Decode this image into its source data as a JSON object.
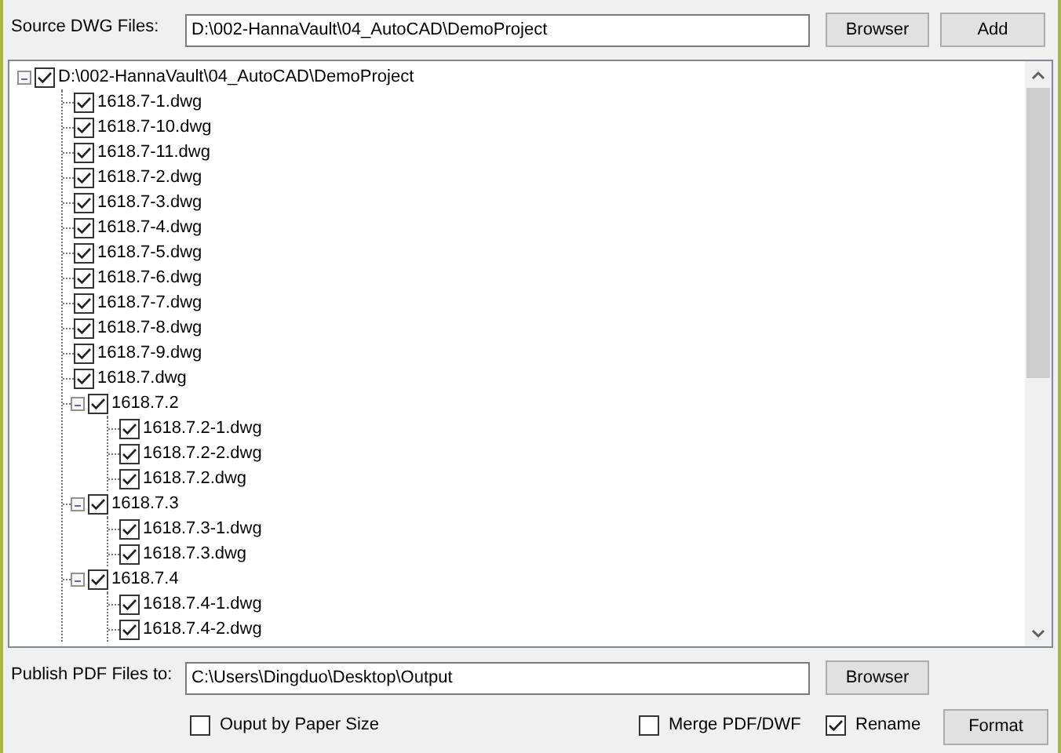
{
  "source": {
    "label": "Source DWG Files:",
    "value": "D:\\002-HannaVault\\04_AutoCAD\\DemoProject",
    "buttons": [
      "Browser",
      "Add"
    ]
  },
  "tree": {
    "label": "D:\\002-HannaVault\\04_AutoCAD\\DemoProject",
    "checked": true,
    "expanded": true,
    "children": [
      {
        "label": "1618.7-1.dwg",
        "checked": true
      },
      {
        "label": "1618.7-10.dwg",
        "checked": true
      },
      {
        "label": "1618.7-11.dwg",
        "checked": true
      },
      {
        "label": "1618.7-2.dwg",
        "checked": true
      },
      {
        "label": "1618.7-3.dwg",
        "checked": true
      },
      {
        "label": "1618.7-4.dwg",
        "checked": true
      },
      {
        "label": "1618.7-5.dwg",
        "checked": true
      },
      {
        "label": "1618.7-6.dwg",
        "checked": true
      },
      {
        "label": "1618.7-7.dwg",
        "checked": true
      },
      {
        "label": "1618.7-8.dwg",
        "checked": true
      },
      {
        "label": "1618.7-9.dwg",
        "checked": true
      },
      {
        "label": "1618.7.dwg",
        "checked": true
      },
      {
        "label": "1618.7.2",
        "checked": true,
        "expanded": true,
        "children": [
          {
            "label": "1618.7.2-1.dwg",
            "checked": true
          },
          {
            "label": "1618.7.2-2.dwg",
            "checked": true
          },
          {
            "label": "1618.7.2.dwg",
            "checked": true
          }
        ]
      },
      {
        "label": "1618.7.3",
        "checked": true,
        "expanded": true,
        "children": [
          {
            "label": "1618.7.3-1.dwg",
            "checked": true
          },
          {
            "label": "1618.7.3.dwg",
            "checked": true
          }
        ]
      },
      {
        "label": "1618.7.4",
        "checked": true,
        "expanded": true,
        "children": [
          {
            "label": "1618.7.4-1.dwg",
            "checked": true
          },
          {
            "label": "1618.7.4-2.dwg",
            "checked": true
          }
        ]
      }
    ]
  },
  "publish": {
    "label": "Publish PDF Files to:",
    "value": "C:\\Users\\Dingduo\\Desktop\\Output",
    "button": "Browser"
  },
  "options": [
    {
      "label": "Ouput by Paper Size",
      "checked": false
    },
    {
      "label": "Merge PDF/DWF",
      "checked": false
    },
    {
      "label": "Rename",
      "checked": true
    }
  ],
  "format_button": "Format"
}
